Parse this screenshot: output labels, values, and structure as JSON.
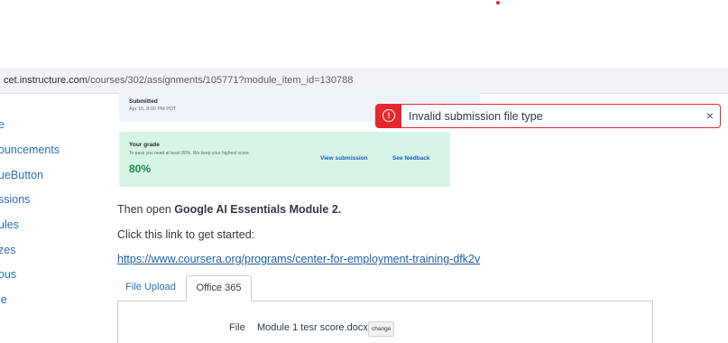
{
  "browser": {
    "url_domain": "cet.instructure.com",
    "url_path": "/courses/302/assignments/105771?module_item_id=130788"
  },
  "sidebar": {
    "items": [
      {
        "label": "e"
      },
      {
        "label": "ouncements"
      },
      {
        "label": "ueButton"
      },
      {
        "label": "ssions"
      },
      {
        "label": "ules"
      },
      {
        "label": "zes"
      },
      {
        "label": "ous"
      },
      {
        "label": "le"
      }
    ]
  },
  "submitted_card": {
    "title": "Submitted",
    "date": "Apr 15, 8:00 PM PDT"
  },
  "grade_card": {
    "title": "Your grade",
    "subtitle": "To pass you need at least 80%. We keep your highest score.",
    "percentage": "80%",
    "view_submission": "View submission",
    "see_feedback": "See feedback"
  },
  "toast": {
    "icon": "error-icon",
    "message": "Invalid submission file type",
    "close": "×"
  },
  "content": {
    "open_prefix": "Then open ",
    "open_bold": "Google AI Essentials Module 2.",
    "click_line": "Click this link to get started:",
    "link": "https://www.coursera.org/programs/center-for-employment-training-dfk2v"
  },
  "tabs": [
    {
      "label": "File Upload"
    },
    {
      "label": "Office 365"
    }
  ],
  "upload_panel": {
    "file_label": "File",
    "file_name": "Module 1 tesr score.docx",
    "change_label": "change"
  },
  "colors": {
    "error": "#e6272b",
    "grade_bg": "#d7f5e6",
    "grade_pct": "#1c8a4f",
    "link": "#1f5fa8"
  }
}
